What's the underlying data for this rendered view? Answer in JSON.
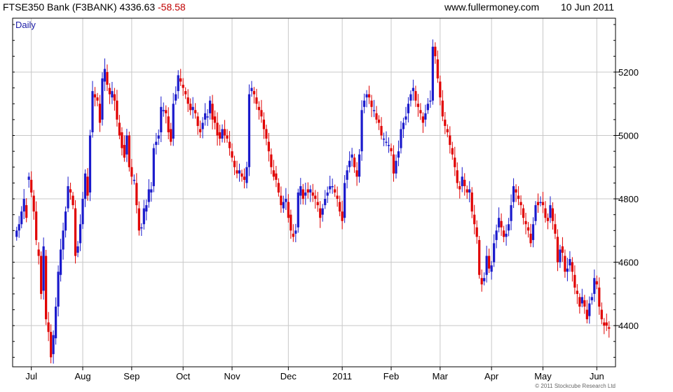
{
  "header": {
    "instrument": "FTSE350 Bank (F3BANK)",
    "last": "4336.63",
    "change": "-58.58",
    "website": "www.fullermoney.com",
    "date": "10 Jun 2011"
  },
  "colors": {
    "up": "#1a1acc",
    "down": "#e00000",
    "grid": "#c8c8c8",
    "frame": "#000000"
  },
  "chart_data": {
    "type": "ohlc",
    "interval_label": "Daily",
    "copyright": "© 2011 Stockcube Research Ltd",
    "ylim": [
      4270,
      5370
    ],
    "y_ticks": [
      4400,
      4600,
      4800,
      5000,
      5200
    ],
    "y_tick_labels": [
      "4400",
      "4600",
      "4800",
      "5000",
      "5200"
    ],
    "x_tick_labels": [
      "Jul",
      "Aug",
      "Sep",
      "Oct",
      "Nov",
      "Dec",
      "2011",
      "Feb",
      "Mar",
      "Apr",
      "May",
      "Jun"
    ],
    "x_tick_index": [
      6,
      27,
      47,
      68,
      88,
      111,
      133,
      153,
      173,
      194,
      215,
      237
    ],
    "close": [
      4700,
      4720,
      4760,
      4800,
      4740,
      4870,
      4820,
      4760,
      4670,
      4620,
      4500,
      4650,
      4420,
      4380,
      4300,
      4370,
      4460,
      4570,
      4640,
      4700,
      4760,
      4840,
      4820,
      4780,
      4620,
      4650,
      4720,
      4800,
      4880,
      4810,
      5000,
      5140,
      5120,
      5110,
      5040,
      5180,
      5210,
      5160,
      5130,
      5140,
      5110,
      5050,
      5000,
      4960,
      4930,
      5000,
      4900,
      4870,
      4860,
      4780,
      4700,
      4710,
      4770,
      4780,
      4830,
      4830,
      4960,
      4980,
      5000,
      5090,
      5080,
      5070,
      5010,
      4980,
      5100,
      5130,
      5190,
      5170,
      5150,
      5130,
      5100,
      5080,
      5090,
      5070,
      5030,
      5010,
      5040,
      5070,
      5060,
      5110,
      5050,
      5040,
      5000,
      4990,
      5020,
      5000,
      4990,
      4960,
      4930,
      4900,
      4880,
      4890,
      4870,
      4860,
      4900,
      5130,
      5150,
      5130,
      5100,
      5080,
      5060,
      5020,
      4990,
      4950,
      4900,
      4870,
      4860,
      4820,
      4780,
      4790,
      4800,
      4740,
      4700,
      4680,
      4700,
      4820,
      4840,
      4800,
      4820,
      4820,
      4830,
      4810,
      4800,
      4780,
      4740,
      4770,
      4800,
      4820,
      4840,
      4840,
      4820,
      4800,
      4760,
      4730,
      4850,
      4890,
      4920,
      4940,
      4900,
      4870,
      4940,
      5080,
      5110,
      5130,
      5120,
      5090,
      5080,
      5050,
      5040,
      5000,
      4990,
      4980,
      4970,
      4950,
      4880,
      4920,
      4950,
      5020,
      5040,
      5060,
      5100,
      5130,
      5150,
      5110,
      5090,
      5070,
      5040,
      5070,
      5100,
      5110,
      5280,
      5250,
      5180,
      5120,
      5060,
      5030,
      5010,
      4970,
      4940,
      4900,
      4850,
      4830,
      4870,
      4840,
      4820,
      4830,
      4760,
      4720,
      4680,
      4560,
      4530,
      4550,
      4620,
      4580,
      4590,
      4660,
      4700,
      4740,
      4710,
      4680,
      4690,
      4720,
      4780,
      4840,
      4820,
      4800,
      4780,
      4740,
      4720,
      4700,
      4660,
      4720,
      4780,
      4780,
      4790,
      4780,
      4740,
      4730,
      4780,
      4730,
      4690,
      4600,
      4640,
      4630,
      4570,
      4580,
      4610,
      4570,
      4520,
      4500,
      4460,
      4490,
      4460,
      4420,
      4470,
      4490,
      4550,
      4530,
      4460,
      4420,
      4400,
      4400,
      4390,
      4336.63
    ],
    "open": [
      4680,
      4700,
      4720,
      4760,
      4780,
      4860,
      4860,
      4810,
      4760,
      4640,
      4620,
      4510,
      4620,
      4410,
      4380,
      4310,
      4360,
      4460,
      4560,
      4640,
      4700,
      4770,
      4830,
      4810,
      4770,
      4630,
      4660,
      4720,
      4800,
      4870,
      4820,
      5010,
      5130,
      5120,
      5100,
      5050,
      5170,
      5200,
      5150,
      5120,
      5130,
      5110,
      5040,
      5010,
      4970,
      4940,
      5000,
      4900,
      4860,
      4850,
      4770,
      4710,
      4720,
      4760,
      4790,
      4820,
      4840,
      4970,
      4990,
      5010,
      5080,
      5080,
      5060,
      5020,
      4990,
      5110,
      5140,
      5180,
      5160,
      5140,
      5120,
      5100,
      5080,
      5080,
      5060,
      5020,
      5020,
      5050,
      5060,
      5070,
      5100,
      5060,
      5040,
      5010,
      4990,
      5020,
      5000,
      4980,
      4950,
      4920,
      4890,
      4880,
      4880,
      4870,
      4850,
      4900,
      5140,
      5140,
      5120,
      5090,
      5080,
      5050,
      5020,
      4980,
      4940,
      4890,
      4880,
      4850,
      4810,
      4770,
      4790,
      4790,
      4750,
      4690,
      4690,
      4710,
      4810,
      4830,
      4810,
      4830,
      4820,
      4820,
      4810,
      4790,
      4770,
      4750,
      4780,
      4810,
      4830,
      4840,
      4830,
      4810,
      4790,
      4760,
      4740,
      4860,
      4900,
      4930,
      4930,
      4890,
      4870,
      4950,
      5090,
      5120,
      5130,
      5110,
      5080,
      5070,
      5050,
      5030,
      4990,
      4980,
      4970,
      4960,
      4940,
      4880,
      4930,
      4960,
      5020,
      5050,
      5070,
      5110,
      5140,
      5140,
      5100,
      5080,
      5060,
      5050,
      5080,
      5110,
      5110,
      5280,
      5240,
      5170,
      5110,
      5050,
      5020,
      5000,
      4960,
      4930,
      4890,
      4840,
      4840,
      4860,
      4830,
      4820,
      4820,
      4750,
      4710,
      4670,
      4550,
      4540,
      4560,
      4620,
      4570,
      4600,
      4670,
      4710,
      4730,
      4700,
      4680,
      4700,
      4730,
      4790,
      4830,
      4810,
      4790,
      4770,
      4730,
      4710,
      4690,
      4670,
      4730,
      4790,
      4790,
      4790,
      4770,
      4740,
      4740,
      4770,
      4720,
      4680,
      4600,
      4650,
      4620,
      4570,
      4590,
      4600,
      4560,
      4510,
      4490,
      4470,
      4480,
      4450,
      4430,
      4480,
      4500,
      4540,
      4520,
      4450,
      4410,
      4410,
      4395
    ]
  }
}
